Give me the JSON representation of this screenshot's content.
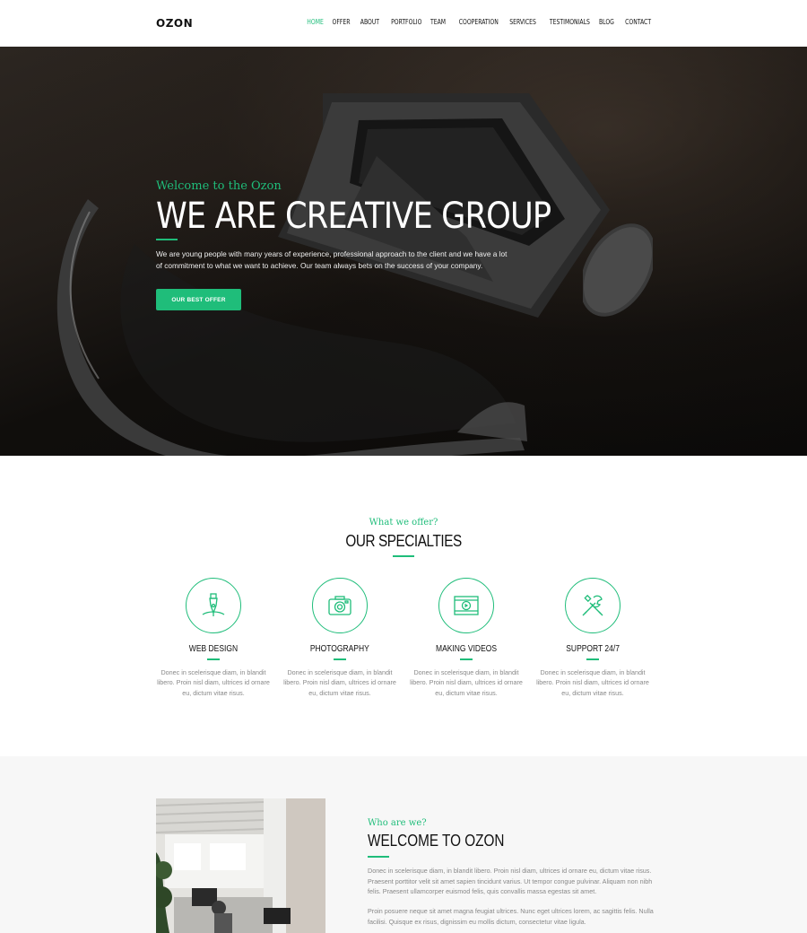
{
  "nav": {
    "logo": "OZON",
    "items": [
      "HOME",
      "OFFER",
      "ABOUT",
      "PORTFOLIO",
      "TEAM",
      "COOPERATION",
      "SERVICES",
      "TESTIMONIALS",
      "BLOG",
      "CONTACT"
    ],
    "active": "HOME"
  },
  "hero": {
    "subtitle": "Welcome to the Ozon",
    "title": "WE ARE CREATIVE GROUP",
    "text": "We are young people with many years of experience, professional approach to the client and we have a lot of commitment to what we want to achieve. Our team always bets on the success of your company.",
    "button": "OUR BEST OFFER"
  },
  "specialties": {
    "subtitle": "What we offer?",
    "title": "OUR SPECIALTIES",
    "items": [
      {
        "title": "WEB DESIGN",
        "icon": "pen-nib-icon",
        "text": "Donec in scelerisque diam, in blandit libero. Proin nisl diam, ultrices id ornare eu, dictum vitae risus."
      },
      {
        "title": "PHOTOGRAPHY",
        "icon": "camera-icon",
        "text": "Donec in scelerisque diam, in blandit libero. Proin nisl diam, ultrices id ornare eu, dictum vitae risus."
      },
      {
        "title": "MAKING VIDEOS",
        "icon": "film-icon",
        "text": "Donec in scelerisque diam, in blandit libero. Proin nisl diam, ultrices id ornare eu, dictum vitae risus."
      },
      {
        "title": "SUPPORT 24/7",
        "icon": "tools-icon",
        "text": "Donec in scelerisque diam, in blandit libero. Proin nisl diam, ultrices id ornare eu, dictum vitae risus."
      }
    ]
  },
  "about": {
    "subtitle": "Who are we?",
    "title": "WELCOME TO OZON",
    "p1": "Donec in scelerisque diam, in blandit libero. Proin nisl diam, ultrices id ornare eu, dictum vitae risus. Praesent porttitor velit sit amet sapien tincidunt varius. Ut tempor congue pulvinar. Aliquam non nibh felis. Praesent ullamcorper euismod felis, quis convallis massa egestas sit amet.",
    "p2": "Proin posuere neque sit amet magna feugiat ultrices. Nunc eget ultrices lorem, ac sagittis felis. Nulla facilisi. Quisque ex risus, dignissim eu mollis dictum, consectetur vitae ligula."
  },
  "colors": {
    "accent": "#1fbd7a",
    "dark": "#111111",
    "muted": "#888888"
  }
}
